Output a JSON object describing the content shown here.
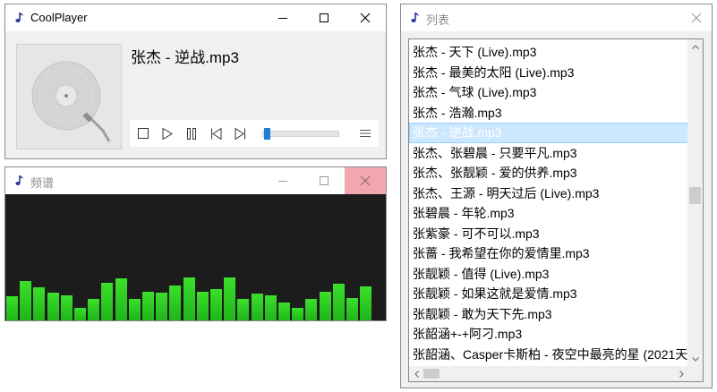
{
  "player": {
    "title": "CoolPlayer",
    "now_playing": "张杰 - 逆战.mp3",
    "progress": 0.03
  },
  "spectrum": {
    "title": "频谱",
    "accent": "#2fd11f",
    "levels": [
      0.19,
      0.31,
      0.26,
      0.22,
      0.2,
      0.1,
      0.17,
      0.3,
      0.33,
      0.17,
      0.23,
      0.22,
      0.28,
      0.34,
      0.23,
      0.25,
      0.34,
      0.17,
      0.21,
      0.2,
      0.14,
      0.1,
      0.17,
      0.23,
      0.29,
      0.18,
      0.27
    ]
  },
  "playlist": {
    "title": "列表",
    "selected_index": 4,
    "selection_color": "#cce8ff",
    "items": [
      "张杰 - 天下 (Live).mp3",
      "张杰 - 最美的太阳 (Live).mp3",
      "张杰 - 气球 (Live).mp3",
      "张杰 - 浩瀚.mp3",
      "张杰 - 逆战.mp3",
      "张杰、张碧晨 - 只要平凡.mp3",
      "张杰、张靓颖 - 爱的供养.mp3",
      "张杰、王源 - 明天过后 (Live).mp3",
      "张碧晨 - 年轮.mp3",
      "张紫豪 - 可不可以.mp3",
      "张蔷 - 我希望在你的爱情里.mp3",
      "张靓颖 - 值得 (Live).mp3",
      "张靓颖 - 如果这就是爱情.mp3",
      "张靓颖 - 敢为天下先.mp3",
      "张韶涵+-+阿刁.mp3",
      "张韶涵、Casper卡斯柏 - 夜空中最亮的星 (2021天"
    ]
  }
}
